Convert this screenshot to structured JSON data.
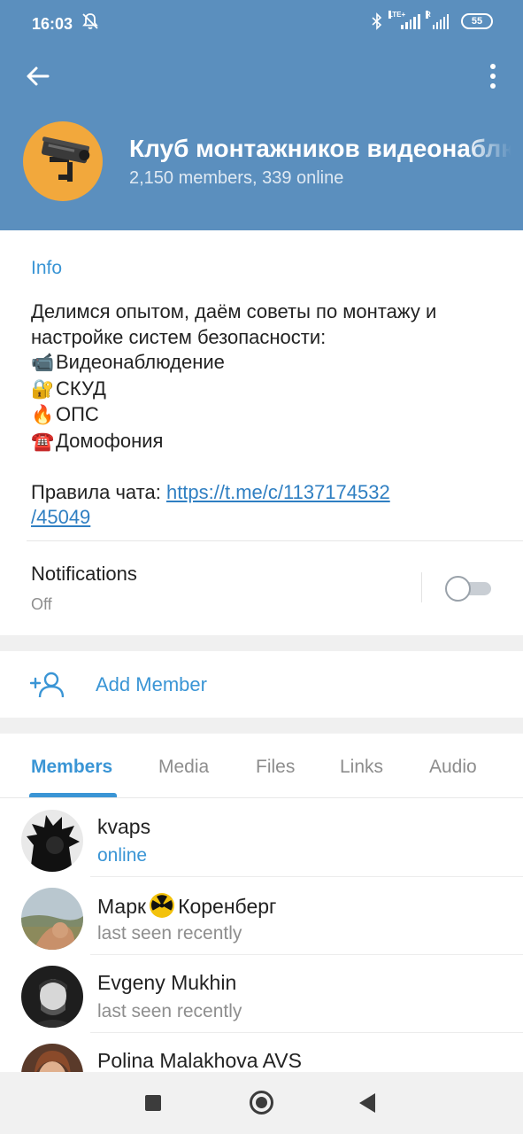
{
  "status_bar": {
    "time": "16:03",
    "network_1": "LTE+",
    "network_2": "R",
    "battery": "55",
    "icons": [
      "mute-bell-icon",
      "bluetooth-icon",
      "signal-icon",
      "battery-icon"
    ]
  },
  "header": {
    "title": "Клуб монтажников видеонаблюдения",
    "subtitle": "2,150 members, 339 online",
    "background": "#5b8fbe"
  },
  "info": {
    "label": "Info",
    "description_line1": "Делимся опытом, даём советы по монтажу и",
    "description_line2": "настройке систем безопасности:",
    "items": [
      {
        "emoji": "📹",
        "text": "Видеонаблюдение"
      },
      {
        "emoji": "🔐",
        "text": "СКУД"
      },
      {
        "emoji": "🔥",
        "text": "ОПС"
      },
      {
        "emoji": "☎️",
        "text": "Домофония"
      }
    ],
    "rules_label": "Правила чата: ",
    "rules_link_part1": "https://t.me/c/1137174532",
    "rules_link_part2": "/45049"
  },
  "notifications": {
    "title": "Notifications",
    "value": "Off",
    "enabled": false
  },
  "add_member": {
    "label": "Add Member"
  },
  "tabs": [
    {
      "label": "Members",
      "active": true
    },
    {
      "label": "Media",
      "active": false
    },
    {
      "label": "Files",
      "active": false
    },
    {
      "label": "Links",
      "active": false
    },
    {
      "label": "Audio",
      "active": false
    }
  ],
  "members": [
    {
      "name": "kvaps",
      "status": "online"
    },
    {
      "name_before": "Марк",
      "name_after": "Коренберг",
      "status": "last seen recently"
    },
    {
      "name": "Evgeny Mukhin",
      "status": "last seen recently"
    },
    {
      "name": "Polina Malakhova AVS",
      "status": ""
    }
  ],
  "colors": {
    "accent": "#3a95d5",
    "header": "#5b8fbe",
    "secondary_text": "#8e8e8e"
  }
}
